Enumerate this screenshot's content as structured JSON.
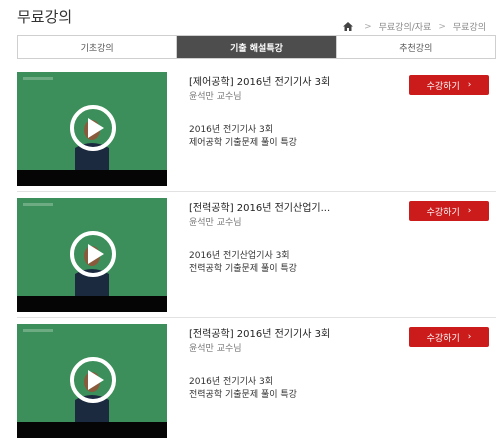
{
  "page_title": "무료강의",
  "breadcrumb": {
    "home_icon": "home-icon",
    "items": [
      "무료강의/자료",
      "무료강의"
    ],
    "separator": ">"
  },
  "tabs": [
    {
      "label": "기초강의",
      "active": false
    },
    {
      "label": "기출 해설특강",
      "active": true
    },
    {
      "label": "추천강의",
      "active": false
    }
  ],
  "courses": [
    {
      "title": "[제어공학] 2016년 전기기사 3회",
      "instructor": "윤석만 교수님",
      "desc_line1": "2016년 전기기사 3회",
      "desc_line2": "제어공학 기출문제 풀이 특강",
      "button_label": "수강하기",
      "button_icon": "chevron-right-icon"
    },
    {
      "title": "[전력공학] 2016년 전기산업기...",
      "instructor": "윤석만 교수님",
      "desc_line1": "2016년 전기산업기사 3회",
      "desc_line2": "전력공학 기출문제 풀이 특강",
      "button_label": "수강하기",
      "button_icon": "chevron-right-icon"
    },
    {
      "title": "[전력공학] 2016년 전기기사 3회",
      "instructor": "윤석만 교수님",
      "desc_line1": "2016년 전기기사 3회",
      "desc_line2": "전력공학 기출문제 풀이 특강",
      "button_label": "수강하기",
      "button_icon": "chevron-right-icon"
    }
  ],
  "colors": {
    "accent": "#cc1b1b",
    "active_tab": "#4d4d4d",
    "board_green": "#3c8f5a"
  }
}
